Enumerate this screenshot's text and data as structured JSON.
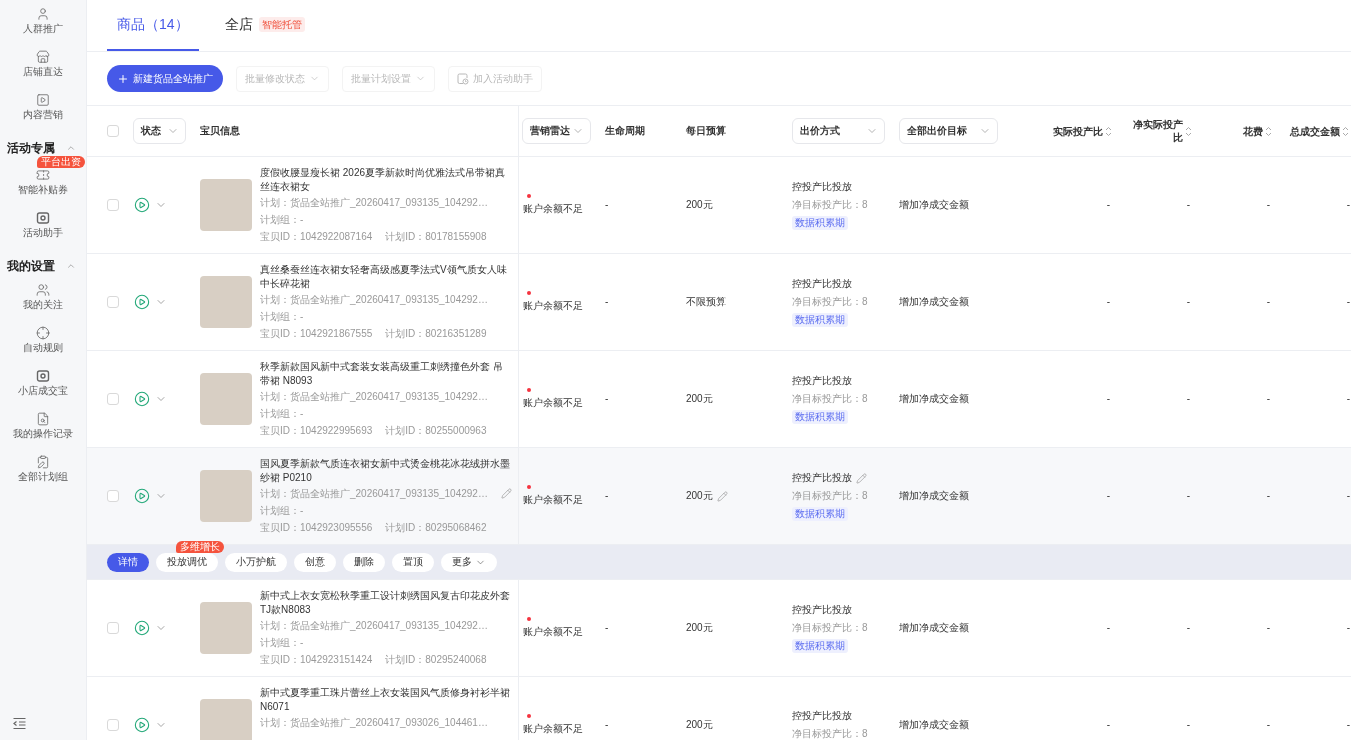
{
  "sidebar": {
    "sections": [
      {
        "items": [
          {
            "label": "人群推广"
          },
          {
            "label": "店铺直达"
          },
          {
            "label": "内容营销"
          }
        ]
      },
      {
        "title": "活动专属",
        "expanded": true,
        "items": [
          {
            "label": "智能补贴券",
            "badge": "平台出资"
          },
          {
            "label": "活动助手"
          }
        ]
      },
      {
        "title": "我的设置",
        "expanded": true,
        "items": [
          {
            "label": "我的关注"
          },
          {
            "label": "自动规则"
          },
          {
            "label": "小店成交宝"
          },
          {
            "label": "我的操作记录"
          },
          {
            "label": "全部计划组"
          }
        ]
      }
    ]
  },
  "tabs": [
    {
      "label": "商品（14）",
      "selected": true
    },
    {
      "label": "全店",
      "selected": false,
      "badge": "智能托管"
    }
  ],
  "toolbar": {
    "create_button": "新建货品全站推广",
    "actions": [
      {
        "kind": "dropdown",
        "label": "批量修改状态",
        "disabled": true
      },
      {
        "kind": "dropdown",
        "label": "批量计划设置",
        "disabled": true
      },
      {
        "kind": "button",
        "label": "加入活动助手",
        "disabled": true
      }
    ]
  },
  "table": {
    "select_all": {
      "checked": false
    },
    "columns": [
      {
        "label": "状态",
        "kind": "filter"
      },
      {
        "label": "宝贝信息",
        "kind": "text"
      },
      {
        "label": "营销雷达",
        "kind": "filter"
      },
      {
        "label": "生命周期",
        "kind": "text"
      },
      {
        "label": "每日预算",
        "kind": "text"
      },
      {
        "label": "出价方式",
        "kind": "filter"
      },
      {
        "label": "全部出价目标",
        "kind": "filter"
      },
      {
        "label": "实际投产比",
        "kind": "sort"
      },
      {
        "label": "净实际投产比",
        "kind": "sort"
      },
      {
        "label": "花费",
        "kind": "sort"
      },
      {
        "label": "总成交金额",
        "kind": "sort"
      }
    ],
    "rows": [
      {
        "checked": false,
        "hovered": false,
        "title": "度假收腰显瘦长裙 2026夏季新款时尚优雅法式吊带裙真丝连衣裙女",
        "plan": "计划：货品全站推广_20260417_093135_104292…",
        "plan_group": "计划组：-",
        "item_id": "宝贝ID：1042922087164",
        "plan_id": "计划ID：80178155908",
        "status": "账户余额不足",
        "lifecycle": "-",
        "budget": "200元",
        "bid_method": "控投产比投放",
        "target": "净目标投产比：8",
        "tag": "数据积累期",
        "bid_goal": "增加净成交金额",
        "metrics": [
          "-",
          "-",
          "-",
          "-"
        ]
      },
      {
        "checked": false,
        "hovered": false,
        "title": "真丝桑蚕丝连衣裙女轻奢高级感夏季法式V领气质女人味中长碎花裙",
        "plan": "计划：货品全站推广_20260417_093135_104292…",
        "plan_group": "计划组：-",
        "item_id": "宝贝ID：1042921867555",
        "plan_id": "计划ID：80216351289",
        "status": "账户余额不足",
        "lifecycle": "-",
        "budget": "不限预算",
        "bid_method": "控投产比投放",
        "target": "净目标投产比：8",
        "tag": "数据积累期",
        "bid_goal": "增加净成交金额",
        "metrics": [
          "-",
          "-",
          "-",
          "-"
        ]
      },
      {
        "checked": false,
        "hovered": false,
        "title": "秋季新款国风新中式套装女装高级重工刺绣撞色外套 吊带裙 N8093",
        "plan": "计划：货品全站推广_20260417_093135_104292…",
        "plan_group": "计划组：-",
        "item_id": "宝贝ID：1042922995693",
        "plan_id": "计划ID：80255000963",
        "status": "账户余额不足",
        "lifecycle": "-",
        "budget": "200元",
        "bid_method": "控投产比投放",
        "target": "净目标投产比：8",
        "tag": "数据积累期",
        "bid_goal": "增加净成交金额",
        "metrics": [
          "-",
          "-",
          "-",
          "-"
        ]
      },
      {
        "checked": false,
        "hovered": true,
        "title": "国风夏季新款气质连衣裙女新中式烫金桃花冰花绒拼水墨纱裙 P0210",
        "plan": "计划：货品全站推广_20260417_093135_104292…",
        "plan_group": "计划组：-",
        "item_id": "宝贝ID：1042923095556",
        "plan_id": "计划ID：80295068462",
        "status": "账户余额不足",
        "lifecycle": "-",
        "budget": "200元",
        "bid_method": "控投产比投放",
        "target": "净目标投产比：8",
        "tag": "数据积累期",
        "bid_goal": "增加净成交金额",
        "metrics": [
          "-",
          "-",
          "-",
          "-"
        ]
      },
      {
        "checked": false,
        "hovered": false,
        "title": "新中式上衣女宽松秋季重工设计刺绣国风复古印花皮外套TJ款N8083",
        "plan": "计划：货品全站推广_20260417_093135_104292…",
        "plan_group": "计划组：-",
        "item_id": "宝贝ID：1042923151424",
        "plan_id": "计划ID：80295240068",
        "status": "账户余额不足",
        "lifecycle": "-",
        "budget": "200元",
        "bid_method": "控投产比投放",
        "target": "净目标投产比：8",
        "tag": "数据积累期",
        "bid_goal": "增加净成交金额",
        "metrics": [
          "-",
          "-",
          "-",
          "-"
        ]
      },
      {
        "checked": false,
        "hovered": false,
        "title": "新中式夏季重工珠片蕾丝上衣女装国风气质修身衬衫半裙N6071",
        "plan": "计划：货品全站推广_20260417_093026_104461…",
        "status": "账户余额不足",
        "lifecycle": "-",
        "budget": "200元",
        "bid_method": "控投产比投放",
        "target": "净目标投产比：8",
        "bid_goal": "增加净成交金额",
        "metrics": [
          "-",
          "-",
          "-",
          "-"
        ]
      }
    ],
    "row_actions": [
      {
        "kind": "button",
        "label": "详情",
        "primary": true
      },
      {
        "kind": "button",
        "label": "投放调优",
        "primary": false,
        "badge": "多维增长"
      },
      {
        "kind": "button",
        "label": "小万护航",
        "primary": false
      },
      {
        "kind": "button",
        "label": "创意",
        "primary": false
      },
      {
        "kind": "button",
        "label": "删除",
        "primary": false
      },
      {
        "kind": "button",
        "label": "置顶",
        "primary": false
      },
      {
        "kind": "menu",
        "label": "更多",
        "primary": false
      }
    ]
  }
}
